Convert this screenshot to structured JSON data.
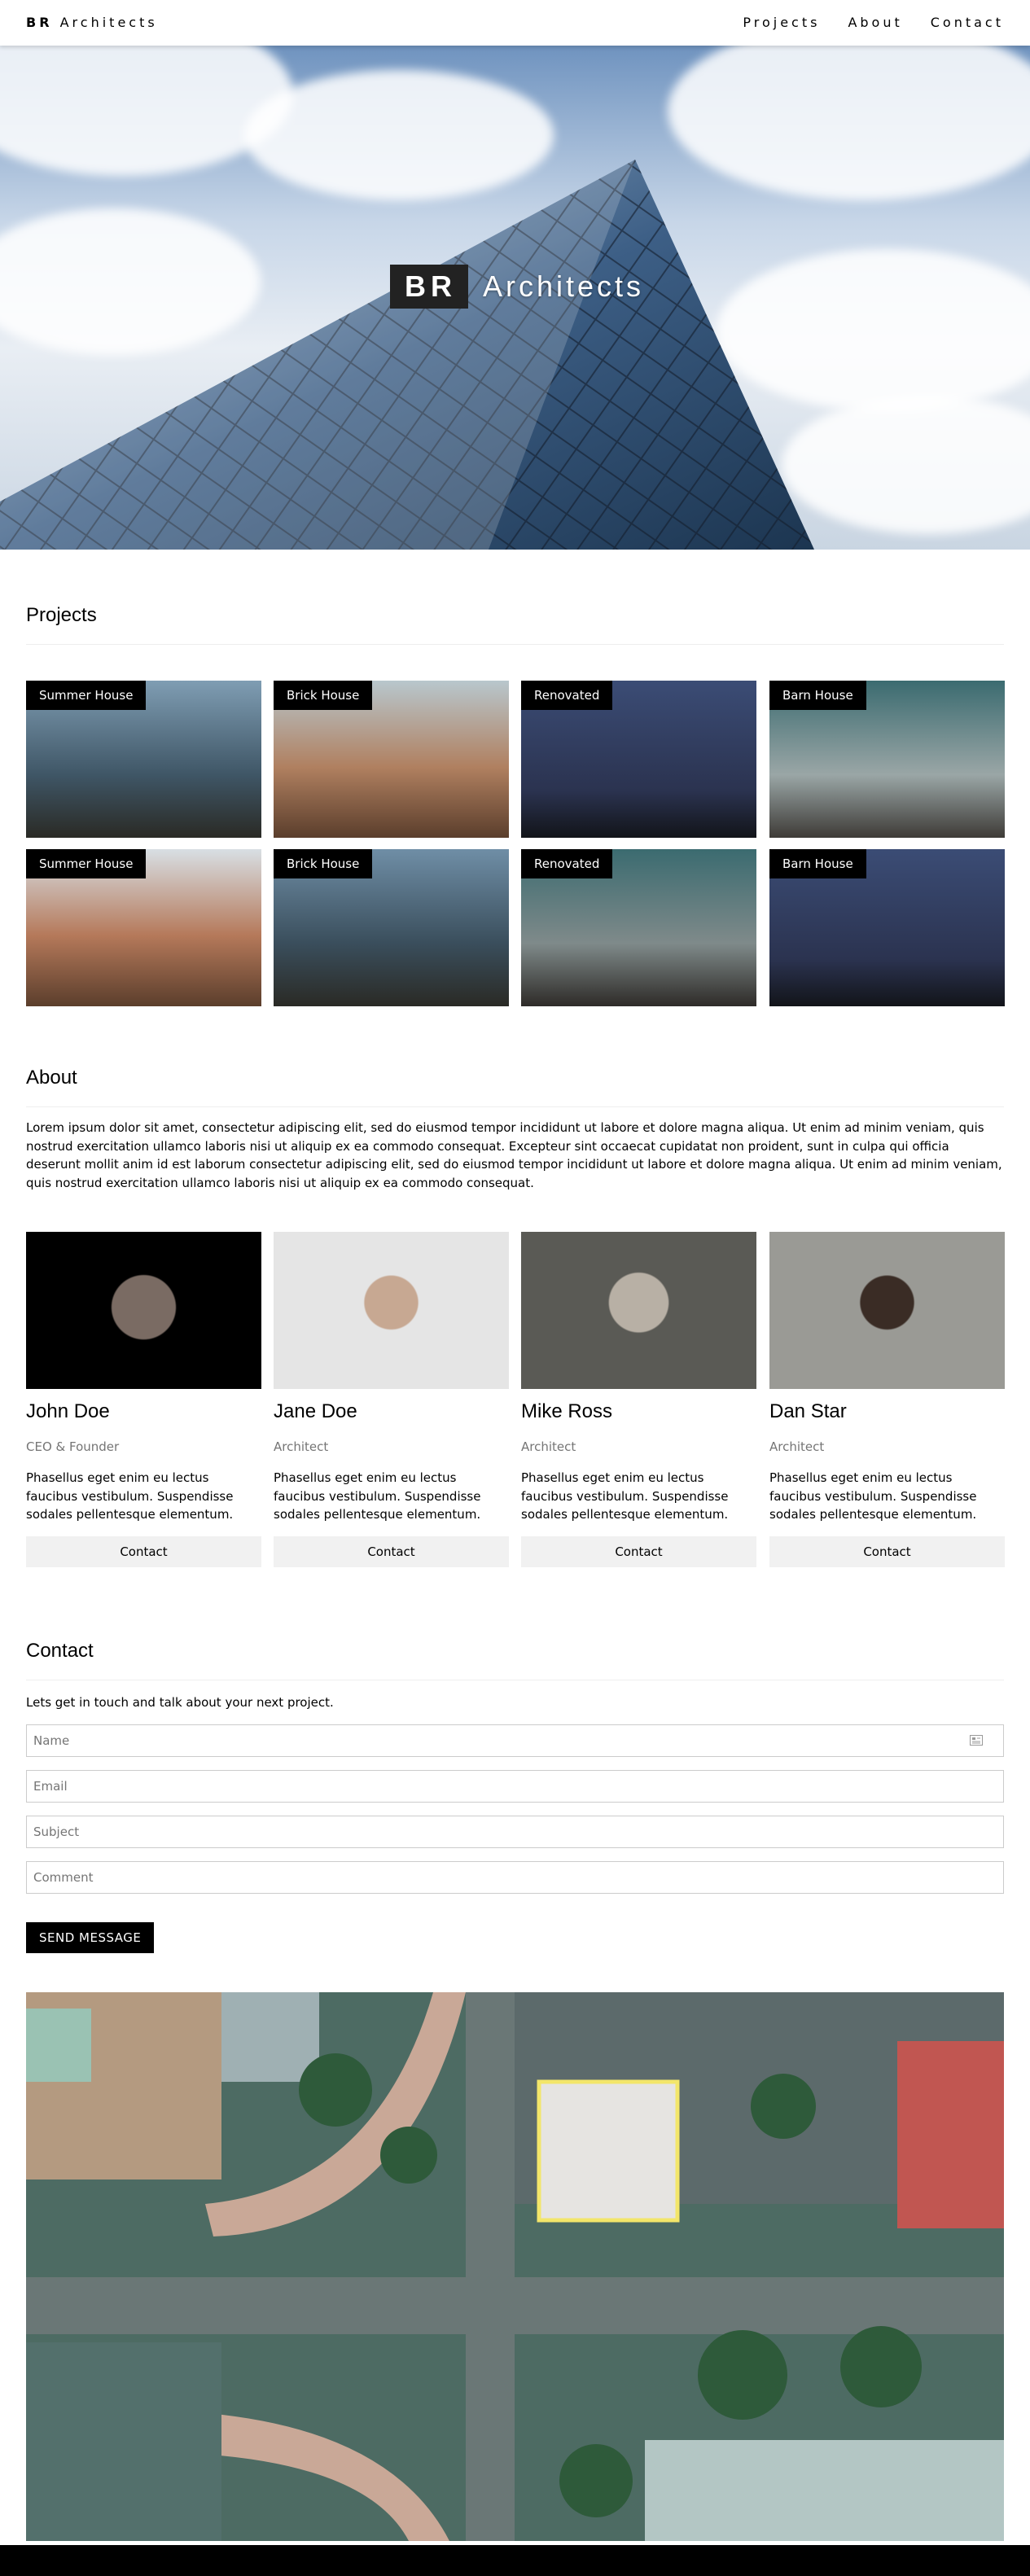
{
  "nav": {
    "brand_bold": "BR",
    "brand_rest": "Architects",
    "links": [
      "Projects",
      "About",
      "Contact"
    ]
  },
  "hero": {
    "box": "BR",
    "word": "Architects"
  },
  "projects": {
    "title": "Projects",
    "cards": [
      {
        "label": "Summer House"
      },
      {
        "label": "Brick House"
      },
      {
        "label": "Renovated"
      },
      {
        "label": "Barn House"
      },
      {
        "label": "Summer House"
      },
      {
        "label": "Brick House"
      },
      {
        "label": "Renovated"
      },
      {
        "label": "Barn House"
      }
    ]
  },
  "about": {
    "title": "About",
    "text": "Lorem ipsum dolor sit amet, consectetur adipiscing elit, sed do eiusmod tempor incididunt ut labore et dolore magna aliqua. Ut enim ad minim veniam, quis nostrud exercitation ullamco laboris nisi ut aliquip ex ea commodo consequat. Excepteur sint occaecat cupidatat non proident, sunt in culpa qui officia deserunt mollit anim id est laborum consectetur adipiscing elit, sed do eiusmod tempor incididunt ut labore et dolore magna aliqua. Ut enim ad minim veniam, quis nostrud exercitation ullamco laboris nisi ut aliquip ex ea commodo consequat."
  },
  "team": [
    {
      "name": "John Doe",
      "role": "CEO & Founder",
      "desc": "Phasellus eget enim eu lectus faucibus vestibulum. Suspendisse sodales pellentesque elementum.",
      "button": "Contact"
    },
    {
      "name": "Jane Doe",
      "role": "Architect",
      "desc": "Phasellus eget enim eu lectus faucibus vestibulum. Suspendisse sodales pellentesque elementum.",
      "button": "Contact"
    },
    {
      "name": "Mike Ross",
      "role": "Architect",
      "desc": "Phasellus eget enim eu lectus faucibus vestibulum. Suspendisse sodales pellentesque elementum.",
      "button": "Contact"
    },
    {
      "name": "Dan Star",
      "role": "Architect",
      "desc": "Phasellus eget enim eu lectus faucibus vestibulum. Suspendisse sodales pellentesque elementum.",
      "button": "Contact"
    }
  ],
  "contact": {
    "title": "Contact",
    "lead": "Lets get in touch and talk about your next project.",
    "fields": {
      "name": {
        "placeholder": "Name"
      },
      "email": {
        "placeholder": "Email"
      },
      "subject": {
        "placeholder": "Subject"
      },
      "comment": {
        "placeholder": "Comment"
      }
    },
    "send": "SEND MESSAGE"
  },
  "colors": {
    "accent": "#000000",
    "button_bg": "#f1f1f1",
    "muted_text": "#757575"
  }
}
